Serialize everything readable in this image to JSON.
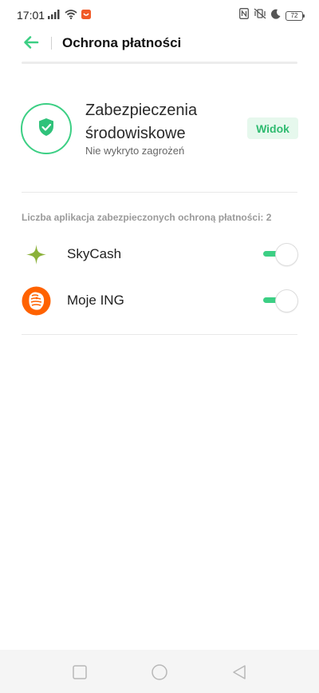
{
  "status_bar": {
    "time": "17:01",
    "battery": "72",
    "icons": [
      "signal-icon",
      "wifi-icon",
      "notification-app-icon",
      "nfc-icon",
      "vibrate-icon",
      "moon-icon",
      "battery-icon"
    ]
  },
  "header": {
    "title": "Ochrona płatności"
  },
  "security": {
    "title_line1": "Zabezpieczenia",
    "title_line2": "środowiskowe",
    "subtitle": "Nie wykryto zagrożeń",
    "view_label": "Widok"
  },
  "apps": {
    "count_label": "Liczba aplikacja zabezpieczonych ochroną płatności: 2",
    "items": [
      {
        "name": "SkyCash",
        "enabled": true
      },
      {
        "name": "Moje ING",
        "enabled": true
      }
    ]
  },
  "colors": {
    "accent": "#3ccf84",
    "accent_bg": "#e6f8ed",
    "ing_orange": "#ff6200"
  }
}
